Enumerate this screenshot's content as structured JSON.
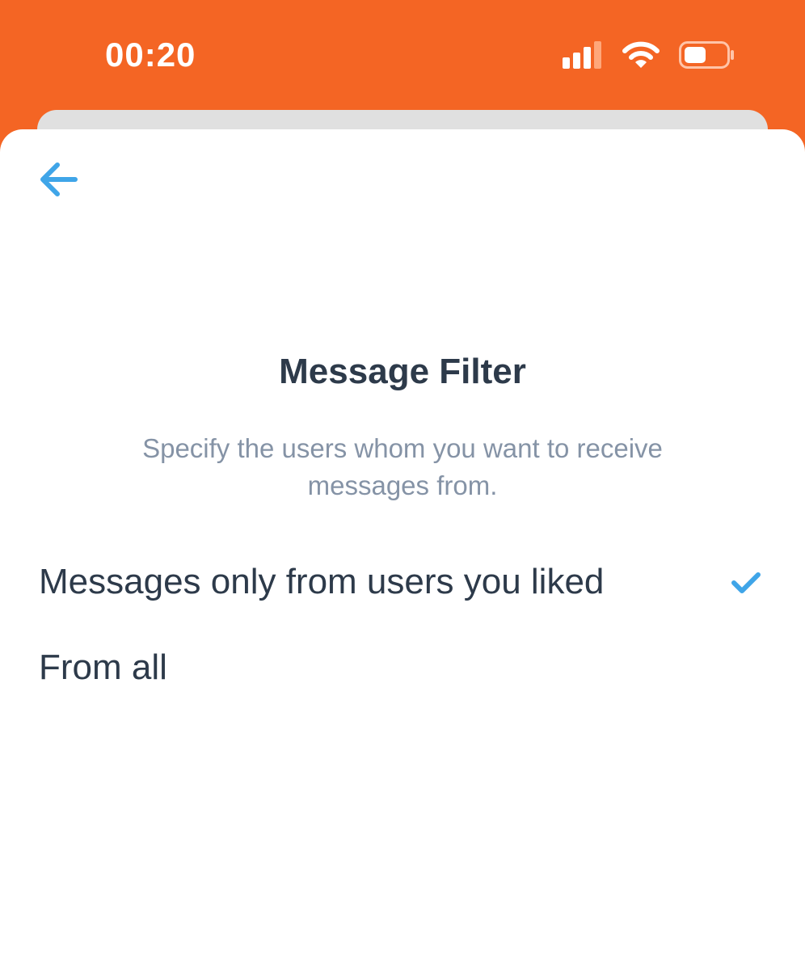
{
  "status_bar": {
    "time": "00:20",
    "icons": [
      "cellular-signal-icon",
      "wifi-icon",
      "battery-icon"
    ]
  },
  "header": {
    "back_icon": "arrow-left-icon"
  },
  "main": {
    "title": "Message Filter",
    "description": "Specify the users whom you want to receive messages from.",
    "options": [
      {
        "label": "Messages only from users you liked",
        "selected": true
      },
      {
        "label": "From all",
        "selected": false
      }
    ]
  },
  "colors": {
    "brand_orange": "#F46524",
    "accent_blue": "#3FA5E8",
    "title_text": "#2D3A4A",
    "muted_text": "#8593A6"
  }
}
